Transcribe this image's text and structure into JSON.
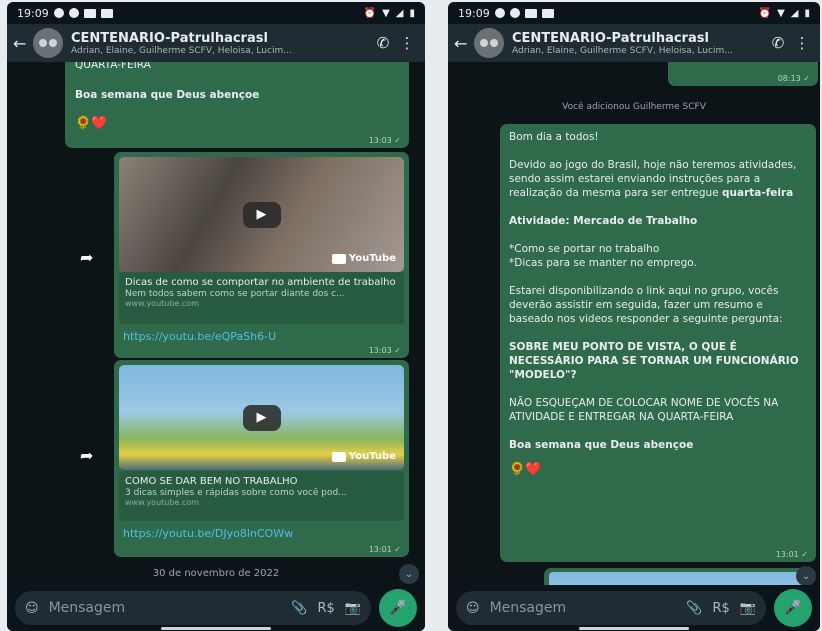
{
  "status": {
    "time": "19:09"
  },
  "header": {
    "group_name": "CENTENARIO-Patrulhacrasl",
    "members": "Adrian, Elaine, Guilherme SCFV, Heloisa, Lucim..."
  },
  "left": {
    "top_message": {
      "cut_line": "QUARTA-FEIRA",
      "blessing": "Boa semana que Deus abençoe",
      "emoji": "🌻❤️",
      "time": "13:03 ✓"
    },
    "video1": {
      "brand": "YouTube",
      "title": "Dicas de como se comportar no ambiente de trabalho",
      "description": "Nem todos sabem como se portar diante dos c...",
      "domain": "www.youtube.com",
      "link": "https://youtu.be/eQPaSh6-U",
      "time": "13:03 ✓"
    },
    "video2": {
      "brand": "YouTube",
      "title": "COMO SE DAR BEM NO TRABALHO",
      "description": "3 dicas simples e rápidas sobre como você pod...",
      "domain": "www.youtube.com",
      "link": "https://youtu.be/DJyo8lnCOWw",
      "time": "13:01 ✓"
    },
    "date_chip": "30 de novembro de 2022",
    "input_placeholder": "Mensagem"
  },
  "right": {
    "prev_time": "08:13 ✓",
    "system_message": "Você adicionou Guilherme SCFV",
    "message": {
      "greeting": "Bom dia a todos!",
      "para1": "Devido ao jogo do Brasil, hoje não teremos atividades, sendo assim estarei enviando instruções para a realização da mesma para ser entregue ",
      "para1_bold": "quarta-feira",
      "activity": "Atividade: Mercado de Trabalho",
      "bullet1": "*Como se portar no trabalho",
      "bullet2": "*Dicas para se manter no emprego.",
      "para2": "Estarei disponibilizando o link aqui no grupo, vocês deverão assistir em seguida, fazer um resumo e baseado nos videos responder a seguinte pergunta:",
      "question": "SOBRE MEU PONTO DE VISTA, O QUE É NECESSÁRIO PARA SE TORNAR UM FUNCIONÁRIO \"MODELO\"?",
      "note": "NÃO ESQUEÇAM DE COLOCAR NOME DE VOCÊS NA ATIVIDADE E ENTREGAR NA QUARTA-FEIRA",
      "blessing": "Boa semana que Deus abençoe",
      "emoji": "🌻❤️",
      "time": "13:01 ✓"
    },
    "input_placeholder": "Mensagem"
  },
  "colors": {
    "bubble_out": "#2f6a4a",
    "header": "#1f2c34",
    "link": "#53bdeb",
    "mic": "#25a36f"
  },
  "icons": [
    "back-arrow-icon",
    "group-avatar-icon",
    "add-call-icon",
    "more-vert-icon",
    "forward-icon",
    "play-icon",
    "youtube-icon",
    "emoji-icon",
    "attach-icon",
    "payment-icon",
    "camera-icon",
    "mic-icon",
    "scroll-down-icon"
  ]
}
